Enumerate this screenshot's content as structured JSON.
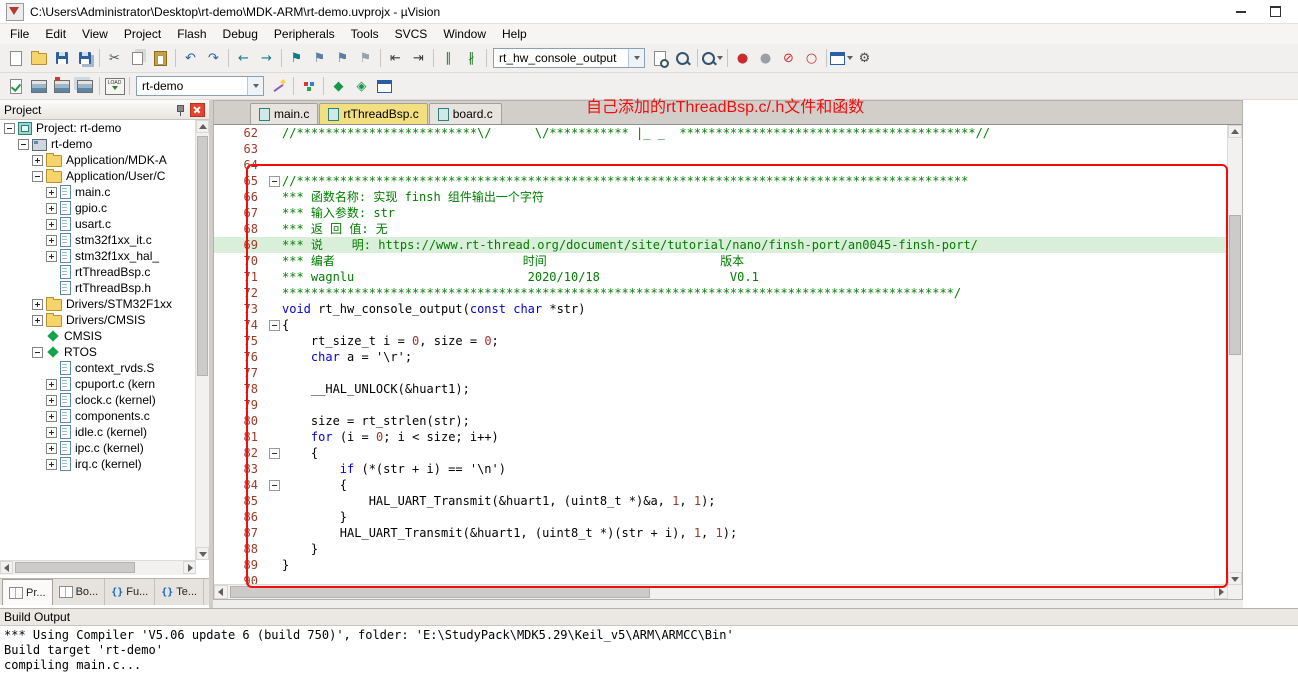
{
  "window": {
    "title": "C:\\Users\\Administrator\\Desktop\\rt-demo\\MDK-ARM\\rt-demo.uvprojx - µVision"
  },
  "menu": {
    "items": [
      "File",
      "Edit",
      "View",
      "Project",
      "Flash",
      "Debug",
      "Peripherals",
      "Tools",
      "SVCS",
      "Window",
      "Help"
    ]
  },
  "toolbar1": {
    "items": [
      {
        "name": "new-file",
        "icon": "page"
      },
      {
        "name": "open-file",
        "icon": "folder"
      },
      {
        "name": "save",
        "icon": "floppy"
      },
      {
        "name": "save-all",
        "icon": "floppy2"
      },
      {
        "name": "sep"
      },
      {
        "name": "cut",
        "glyph": "✂",
        "color": "#44505a"
      },
      {
        "name": "copy",
        "icon": "copy"
      },
      {
        "name": "paste",
        "icon": "paste"
      },
      {
        "name": "sep"
      },
      {
        "name": "undo",
        "glyph": "↶",
        "color": "#2a6099"
      },
      {
        "name": "redo",
        "glyph": "↷",
        "color": "#2a6099"
      },
      {
        "name": "sep"
      },
      {
        "name": "nav-back",
        "glyph": "←",
        "color": "#0e7c87"
      },
      {
        "name": "nav-forward",
        "glyph": "→",
        "color": "#0e7c87"
      },
      {
        "name": "sep"
      },
      {
        "name": "bookmark-toggle",
        "glyph": "⚑",
        "color": "#0e7c87"
      },
      {
        "name": "bookmark-prev",
        "glyph": "⚑",
        "color": "#5c7fa3"
      },
      {
        "name": "bookmark-next",
        "glyph": "⚑",
        "color": "#5c7fa3"
      },
      {
        "name": "bookmark-clear-all",
        "glyph": "⚑",
        "color": "#98a2ab"
      },
      {
        "name": "sep"
      },
      {
        "name": "unindent",
        "glyph": "⇤",
        "color": "#3a3a3a"
      },
      {
        "name": "indent",
        "glyph": "⇥",
        "color": "#3a3a3a"
      },
      {
        "name": "sep"
      },
      {
        "name": "comment-selection",
        "glyph": "∥",
        "color": "#2e7d32"
      },
      {
        "name": "uncomment-selection",
        "glyph": "∦",
        "color": "#2e7d32"
      },
      {
        "name": "sep"
      },
      {
        "name": "function-navigator",
        "combo": true,
        "value": "rt_hw_console_output",
        "width": 152
      },
      {
        "name": "find-in-files",
        "icon": "pagemag"
      },
      {
        "name": "find",
        "icon": "mag"
      },
      {
        "name": "sep"
      },
      {
        "name": "search-scope",
        "icon": "mag",
        "dropdown": true
      },
      {
        "name": "sep"
      },
      {
        "name": "insert-breakpoint",
        "glyph": "●",
        "color": "#cc2b2b"
      },
      {
        "name": "disable-breakpoint",
        "glyph": "●",
        "color": "#9aa0a6"
      },
      {
        "name": "kill-all-breakpoints",
        "glyph": "⊘",
        "color": "#cc2b2b"
      },
      {
        "name": "enable-all-breakpoints",
        "glyph": "○",
        "color": "#cc2b2b"
      },
      {
        "name": "sep"
      },
      {
        "name": "debug-windows",
        "icon": "window",
        "dropdown": true
      },
      {
        "name": "configure",
        "glyph": "⚙",
        "color": "#4a4a4a"
      }
    ]
  },
  "toolbar2": {
    "items": [
      {
        "name": "translate",
        "icon": "pagecheck"
      },
      {
        "name": "build",
        "icon": "build"
      },
      {
        "name": "rebuild",
        "icon": "rebuild"
      },
      {
        "name": "batch-build",
        "icon": "batch"
      },
      {
        "name": "sep"
      },
      {
        "name": "download",
        "icon": "load",
        "label": "LOAD"
      },
      {
        "name": "sep"
      },
      {
        "name": "target-select",
        "combo": true,
        "value": "rt-demo",
        "width": 128
      },
      {
        "name": "options-for-target",
        "icon": "wand"
      },
      {
        "name": "sep"
      },
      {
        "name": "file-extensions",
        "icon": "bricks"
      },
      {
        "name": "sep"
      },
      {
        "name": "manage-rte",
        "glyph": "◆",
        "color": "#13994b"
      },
      {
        "name": "pack-installer",
        "glyph": "◈",
        "color": "#13994b"
      },
      {
        "name": "window-layout",
        "icon": "window"
      }
    ]
  },
  "annotation": {
    "text": "自己添加的rtThreadBsp.c/.h文件和函数"
  },
  "project_panel": {
    "title": "Project",
    "tree": [
      {
        "level": 0,
        "expand": "minus",
        "icon": "workspace",
        "label": "Project: rt-demo"
      },
      {
        "level": 1,
        "expand": "minus",
        "icon": "target",
        "label": "rt-demo"
      },
      {
        "level": 2,
        "expand": "plus",
        "icon": "folder",
        "label": "Application/MDK-A"
      },
      {
        "level": 2,
        "expand": "minus",
        "icon": "folder",
        "label": "Application/User/C"
      },
      {
        "level": 3,
        "expand": "plus",
        "icon": "file",
        "label": "main.c"
      },
      {
        "level": 3,
        "expand": "plus",
        "icon": "file",
        "label": "gpio.c"
      },
      {
        "level": 3,
        "expand": "plus",
        "icon": "file",
        "label": "usart.c"
      },
      {
        "level": 3,
        "expand": "plus",
        "icon": "file",
        "label": "stm32f1xx_it.c"
      },
      {
        "level": 3,
        "expand": "plus",
        "icon": "file",
        "label": "stm32f1xx_hal_"
      },
      {
        "level": 3,
        "expand": "none",
        "icon": "file",
        "label": "rtThreadBsp.c"
      },
      {
        "level": 3,
        "expand": "none",
        "icon": "file",
        "label": "rtThreadBsp.h"
      },
      {
        "level": 2,
        "expand": "plus",
        "icon": "folder",
        "label": "Drivers/STM32F1xx"
      },
      {
        "level": 2,
        "expand": "plus",
        "icon": "folder",
        "label": "Drivers/CMSIS"
      },
      {
        "level": 2,
        "expand": "none",
        "icon": "diamond",
        "label": "CMSIS"
      },
      {
        "level": 2,
        "expand": "minus",
        "icon": "diamond",
        "label": "RTOS"
      },
      {
        "level": 3,
        "expand": "none",
        "icon": "file",
        "label": "context_rvds.S"
      },
      {
        "level": 3,
        "expand": "plus",
        "icon": "file",
        "label": "cpuport.c (kern"
      },
      {
        "level": 3,
        "expand": "plus",
        "icon": "file",
        "label": "clock.c (kernel)"
      },
      {
        "level": 3,
        "expand": "plus",
        "icon": "file",
        "label": "components.c"
      },
      {
        "level": 3,
        "expand": "plus",
        "icon": "file",
        "label": "idle.c (kernel)"
      },
      {
        "level": 3,
        "expand": "plus",
        "icon": "file",
        "label": "ipc.c (kernel)"
      },
      {
        "level": 3,
        "expand": "plus",
        "icon": "file",
        "label": "irq.c (kernel)"
      }
    ],
    "bottom_tabs": [
      {
        "name": "project",
        "label": "Pr...",
        "icon": "book",
        "active": true
      },
      {
        "name": "books",
        "label": "Bo...",
        "icon": "book",
        "active": false
      },
      {
        "name": "functions",
        "label": "Fu...",
        "glyph": "{}",
        "active": false
      },
      {
        "name": "templates",
        "label": "Te...",
        "glyph": "{}",
        "active": false
      }
    ]
  },
  "editor": {
    "tabs": [
      {
        "label": "main.c",
        "active": false
      },
      {
        "label": "rtThreadBsp.c",
        "active": true
      },
      {
        "label": "board.c",
        "active": false
      }
    ],
    "lines": [
      {
        "n": 62,
        "segs": [
          {
            "c": "cm",
            "t": "//*************************\\/      \\/*********** |_ _  *****************************************//"
          }
        ]
      },
      {
        "n": 63,
        "segs": []
      },
      {
        "n": 64,
        "segs": []
      },
      {
        "n": 65,
        "fold": "minus",
        "segs": [
          {
            "c": "cm",
            "t": "//*********************************************************************************************"
          }
        ]
      },
      {
        "n": 66,
        "segs": [
          {
            "c": "cm",
            "t": "*** 函数名称: 实现 finsh 组件输出一个字符"
          }
        ]
      },
      {
        "n": 67,
        "segs": [
          {
            "c": "cm",
            "t": "*** 输入参数: str"
          }
        ]
      },
      {
        "n": 68,
        "segs": [
          {
            "c": "cm",
            "t": "*** 返 回 值: 无"
          }
        ]
      },
      {
        "n": 69,
        "hl": true,
        "segs": [
          {
            "c": "cm",
            "t": "*** 说    明: https://www.rt-thread.org/document/site/tutorial/nano/finsh-port/an0045-finsh-port/"
          }
        ]
      },
      {
        "n": 70,
        "segs": [
          {
            "c": "cm",
            "t": "*** 编者                          时间                        版本"
          }
        ]
      },
      {
        "n": 71,
        "segs": [
          {
            "c": "cm",
            "t": "*** wagnlu                        2020/10/18                  V0.1"
          }
        ]
      },
      {
        "n": 72,
        "segs": [
          {
            "c": "cm",
            "t": "*********************************************************************************************/"
          }
        ]
      },
      {
        "n": 73,
        "segs": [
          {
            "c": "kw",
            "t": "void"
          },
          {
            "c": "pl",
            "t": " rt_hw_console_output("
          },
          {
            "c": "kw",
            "t": "const"
          },
          {
            "c": "pl",
            "t": " "
          },
          {
            "c": "kw",
            "t": "char"
          },
          {
            "c": "pl",
            "t": " *str)"
          }
        ]
      },
      {
        "n": 74,
        "fold": "minus",
        "segs": [
          {
            "c": "pl",
            "t": "{"
          }
        ]
      },
      {
        "n": 75,
        "segs": [
          {
            "c": "pl",
            "t": "    rt_size_t i = "
          },
          {
            "c": "num",
            "t": "0"
          },
          {
            "c": "pl",
            "t": ", size = "
          },
          {
            "c": "num",
            "t": "0"
          },
          {
            "c": "pl",
            "t": ";"
          }
        ]
      },
      {
        "n": 76,
        "segs": [
          {
            "c": "pl",
            "t": "    "
          },
          {
            "c": "kw",
            "t": "char"
          },
          {
            "c": "pl",
            "t": " a = "
          },
          {
            "c": "str",
            "t": "'\\r'"
          },
          {
            "c": "pl",
            "t": ";"
          }
        ]
      },
      {
        "n": 77,
        "segs": []
      },
      {
        "n": 78,
        "segs": [
          {
            "c": "pl",
            "t": "    __HAL_UNLOCK(&huart1);"
          }
        ]
      },
      {
        "n": 79,
        "segs": []
      },
      {
        "n": 80,
        "segs": [
          {
            "c": "pl",
            "t": "    size = rt_strlen(str);"
          }
        ]
      },
      {
        "n": 81,
        "segs": [
          {
            "c": "pl",
            "t": "    "
          },
          {
            "c": "kw",
            "t": "for"
          },
          {
            "c": "pl",
            "t": " (i = "
          },
          {
            "c": "num",
            "t": "0"
          },
          {
            "c": "pl",
            "t": "; i < size; i++)"
          }
        ]
      },
      {
        "n": 82,
        "fold": "minus",
        "segs": [
          {
            "c": "pl",
            "t": "    {"
          }
        ]
      },
      {
        "n": 83,
        "segs": [
          {
            "c": "pl",
            "t": "        "
          },
          {
            "c": "kw",
            "t": "if"
          },
          {
            "c": "pl",
            "t": " (*(str + i) == "
          },
          {
            "c": "str",
            "t": "'\\n'"
          },
          {
            "c": "pl",
            "t": ")"
          }
        ]
      },
      {
        "n": 84,
        "fold": "minus",
        "segs": [
          {
            "c": "pl",
            "t": "        {"
          }
        ]
      },
      {
        "n": 85,
        "segs": [
          {
            "c": "pl",
            "t": "            HAL_UART_Transmit(&huart1, (uint8_t *)&a, "
          },
          {
            "c": "num",
            "t": "1"
          },
          {
            "c": "pl",
            "t": ", "
          },
          {
            "c": "num",
            "t": "1"
          },
          {
            "c": "pl",
            "t": ");"
          }
        ]
      },
      {
        "n": 86,
        "segs": [
          {
            "c": "pl",
            "t": "        }"
          }
        ]
      },
      {
        "n": 87,
        "segs": [
          {
            "c": "pl",
            "t": "        HAL_UART_Transmit(&huart1, (uint8_t *)(str + i), "
          },
          {
            "c": "num",
            "t": "1"
          },
          {
            "c": "pl",
            "t": ", "
          },
          {
            "c": "num",
            "t": "1"
          },
          {
            "c": "pl",
            "t": ");"
          }
        ]
      },
      {
        "n": 88,
        "segs": [
          {
            "c": "pl",
            "t": "    }"
          }
        ]
      },
      {
        "n": 89,
        "segs": [
          {
            "c": "pl",
            "t": "}"
          }
        ]
      },
      {
        "n": 90,
        "segs": []
      }
    ]
  },
  "build_output": {
    "title": "Build Output",
    "lines": [
      "*** Using Compiler 'V5.06 update 6 (build 750)', folder: 'E:\\StudyPack\\MDK5.29\\Keil_v5\\ARM\\ARMCC\\Bin'",
      "Build target 'rt-demo'",
      "compiling main.c..."
    ]
  }
}
